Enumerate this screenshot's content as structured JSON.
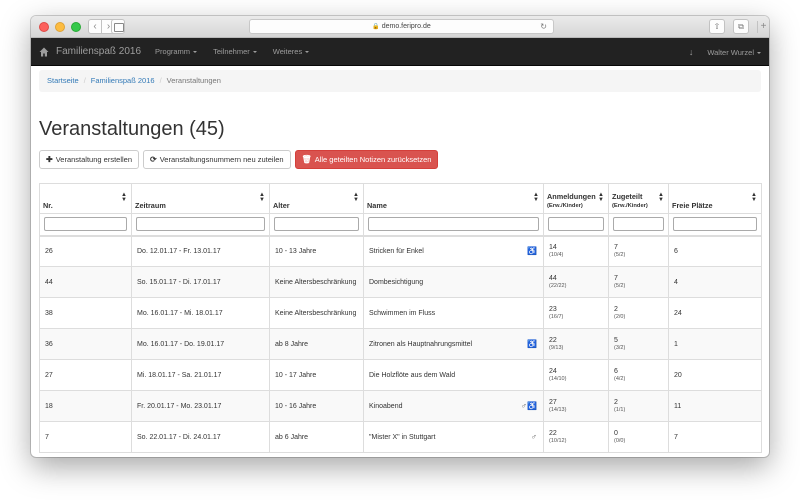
{
  "browser": {
    "url": "demo.feripro.de",
    "back_label": "‹",
    "forward_label": "›"
  },
  "navbar": {
    "brand": "Familienspaß 2016",
    "menus": [
      "Programm",
      "Teilnehmer",
      "Weiteres"
    ],
    "user": "Walter Wurzel"
  },
  "breadcrumb": {
    "home": "Startseite",
    "event": "Familienspaß 2016",
    "current": "Veranstaltungen"
  },
  "page": {
    "title": "Veranstaltungen (45)"
  },
  "toolbar": {
    "create_label": "Veranstaltung erstellen",
    "renumber_label": "Veranstaltungsnummern neu zuteilen",
    "reset_notes_label": "Alle geteilten Notizen zurücksetzen"
  },
  "table": {
    "headers": {
      "nr": "Nr.",
      "zeitraum": "Zeitraum",
      "alter": "Alter",
      "name": "Name",
      "anmeldungen": "Anmeldungen",
      "anmeldungen_sub": "(Erw./Kinder)",
      "zugeteilt": "Zugeteilt",
      "zugeteilt_sub": "(Erw./Kinder)",
      "freie": "Freie Plätze"
    },
    "rows": [
      {
        "nr": "26",
        "zeitraum": "Do. 12.01.17 - Fr. 13.01.17",
        "alter": "10 - 13 Jahre",
        "name": "Stricken für Enkel",
        "icons": "♿",
        "anm": "14",
        "anm_sub": "(10/4)",
        "zug": "7",
        "zug_sub": "(5/2)",
        "frei": "6"
      },
      {
        "nr": "44",
        "zeitraum": "So. 15.01.17 - Di. 17.01.17",
        "alter": "Keine Altersbeschränkung",
        "name": "Dombesichtigung",
        "icons": "",
        "anm": "44",
        "anm_sub": "(22/22)",
        "zug": "7",
        "zug_sub": "(5/2)",
        "frei": "4"
      },
      {
        "nr": "38",
        "zeitraum": "Mo. 16.01.17 - Mi. 18.01.17",
        "alter": "Keine Altersbeschränkung",
        "name": "Schwimmen im Fluss",
        "icons": "",
        "anm": "23",
        "anm_sub": "(16/7)",
        "zug": "2",
        "zug_sub": "(2/0)",
        "frei": "24"
      },
      {
        "nr": "36",
        "zeitraum": "Mo. 16.01.17 - Do. 19.01.17",
        "alter": "ab 8 Jahre",
        "name": "Zitronen als Hauptnahrungsmittel",
        "icons": "♿",
        "anm": "22",
        "anm_sub": "(9/13)",
        "zug": "5",
        "zug_sub": "(3/2)",
        "frei": "1"
      },
      {
        "nr": "27",
        "zeitraum": "Mi. 18.01.17 - Sa. 21.01.17",
        "alter": "10 - 17 Jahre",
        "name": "Die Holzflöte aus dem Wald",
        "icons": "",
        "anm": "24",
        "anm_sub": "(14/10)",
        "zug": "6",
        "zug_sub": "(4/2)",
        "frei": "20"
      },
      {
        "nr": "18",
        "zeitraum": "Fr. 20.01.17 - Mo. 23.01.17",
        "alter": "10 - 16 Jahre",
        "name": "Kinoabend",
        "icons": "♂♿",
        "anm": "27",
        "anm_sub": "(14/13)",
        "zug": "2",
        "zug_sub": "(1/1)",
        "frei": "11"
      },
      {
        "nr": "7",
        "zeitraum": "So. 22.01.17 - Di. 24.01.17",
        "alter": "ab 6 Jahre",
        "name": "\"Mister X\" in Stuttgart",
        "icons": "♂",
        "anm": "22",
        "anm_sub": "(10/12)",
        "zug": "0",
        "zug_sub": "(0/0)",
        "frei": "7"
      }
    ]
  }
}
